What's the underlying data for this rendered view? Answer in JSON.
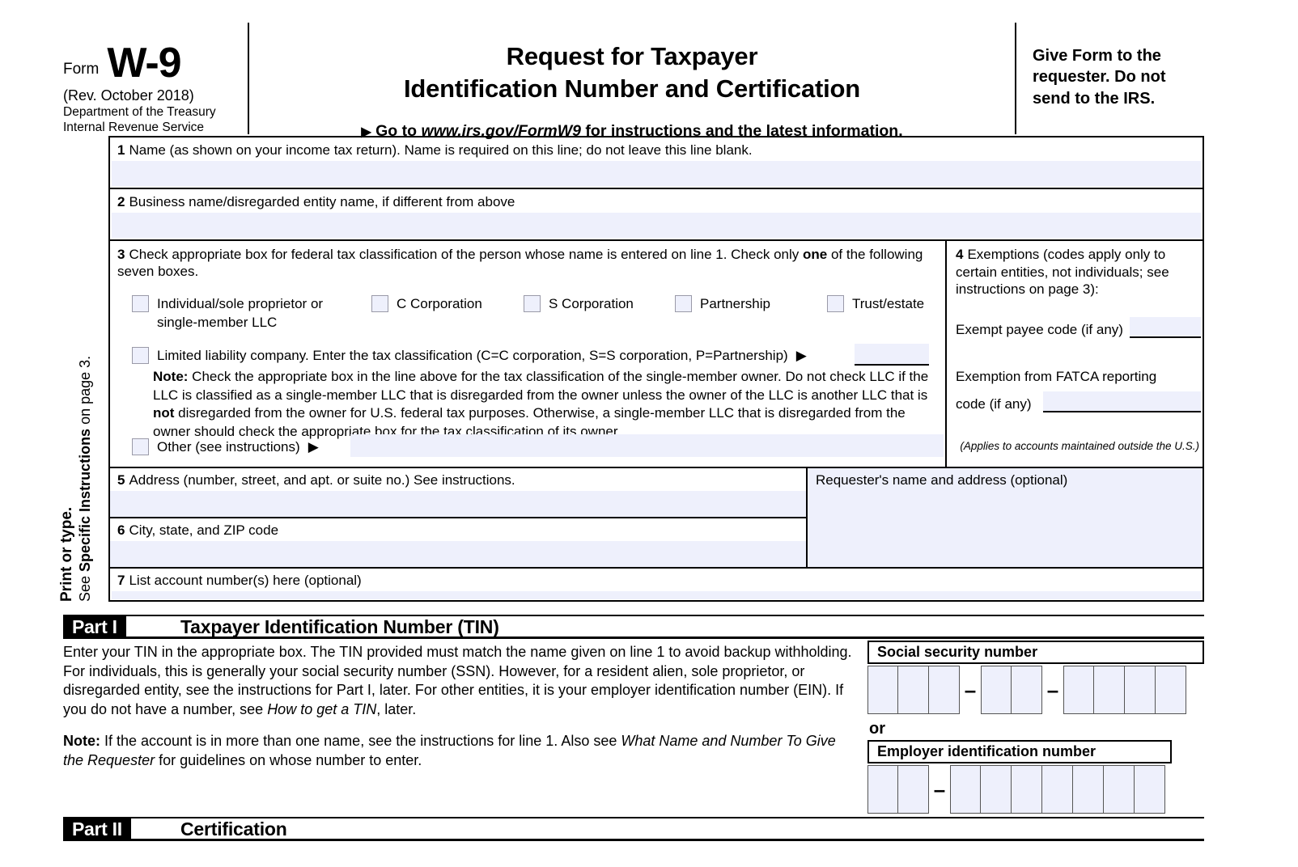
{
  "header": {
    "form_word": "Form",
    "form_number": "W-9",
    "revision": "(Rev. October 2018)",
    "dept_line1": "Department of the Treasury",
    "dept_line2": "Internal Revenue Service",
    "title_line1": "Request for Taxpayer",
    "title_line2": "Identification Number and Certification",
    "goto_arrow": "▶",
    "goto_prefix": "Go to",
    "goto_url": "www.irs.gov/FormW9",
    "goto_suffix": "for instructions and the latest information.",
    "give_form": "Give Form to the requester. Do not send to the IRS."
  },
  "sidebar": {
    "print_or_type": "Print or type.",
    "see_prefix": "See ",
    "see_bold": "Specific Instructions",
    "see_suffix": " on page 3."
  },
  "line1": {
    "number": "1",
    "label": "Name (as shown on your income tax return). Name is required on this line; do not leave this line blank.",
    "value": ""
  },
  "line2": {
    "number": "2",
    "label": "Business name/disregarded entity name, if different from above",
    "value": ""
  },
  "line3": {
    "number": "3",
    "intro_a": "Check appropriate box for federal tax classification of the person whose name is entered on line 1. Check only ",
    "intro_bold": "one",
    "intro_b": " of the following seven boxes.",
    "checkboxes": [
      {
        "id": "individual",
        "label": "Individual/sole proprietor or single-member LLC",
        "checked": false
      },
      {
        "id": "c-corporation",
        "label": "C Corporation",
        "checked": false
      },
      {
        "id": "s-corporation",
        "label": "S Corporation",
        "checked": false
      },
      {
        "id": "partnership",
        "label": "Partnership",
        "checked": false
      },
      {
        "id": "trust-estate",
        "label": "Trust/estate",
        "checked": false
      }
    ],
    "llc": {
      "label": "Limited liability company. Enter the tax classification (C=C corporation, S=S corporation, P=Partnership)",
      "arrow": "▶",
      "value": "",
      "checked": false
    },
    "note_bold": "Note:",
    "note_text_1": " Check the appropriate box in the line above for the tax classification of the single-member owner.  Do not check LLC if the LLC is classified as a single-member LLC that is disregarded from the owner unless the owner of the LLC is another LLC that is ",
    "note_bold_2": "not",
    "note_text_2": " disregarded from the owner for U.S. federal tax purposes. Otherwise, a single-member LLC that is disregarded from the owner should check the appropriate box for the tax classification of its owner.",
    "other": {
      "label": "Other (see instructions)",
      "arrow": "▶",
      "value": "",
      "checked": false
    }
  },
  "line4": {
    "number": "4",
    "heading": "Exemptions (codes apply only to certain entities, not individuals; see instructions on page 3):",
    "exempt_payee_label": "Exempt payee code (if any)",
    "exempt_payee_value": "",
    "fatca_label_line1": "Exemption from FATCA reporting",
    "fatca_label_line2": "code (if any)",
    "fatca_value": "",
    "applies_note": "(Applies to accounts maintained outside the U.S.)"
  },
  "line5": {
    "number": "5",
    "label": "Address (number, street, and apt. or suite no.) See instructions.",
    "value": ""
  },
  "line6": {
    "number": "6",
    "label": "City, state, and ZIP code",
    "value": ""
  },
  "requester": {
    "label": "Requester's name and address (optional)",
    "value": ""
  },
  "line7": {
    "number": "7",
    "label": "List account number(s) here (optional)",
    "value": ""
  },
  "part1": {
    "tag": "Part I",
    "title": "Taxpayer Identification Number (TIN)",
    "body_a": "Enter your TIN in the appropriate box. The TIN provided must match the name given on line 1 to avoid backup withholding. For individuals, this is generally your social security number (SSN). However, for a resident alien, sole proprietor, or disregarded entity, see the instructions for Part I, later. For other entities, it is your employer identification number (EIN). If you do not have a number, see ",
    "body_italic_1": "How to get a TIN",
    "body_b": ", later.",
    "note_bold": "Note:",
    "note_a": " If the account is in more than one name, see the instructions for line 1. Also see ",
    "note_italic": "What Name and Number To Give the Requester",
    "note_b": " for guidelines on whose number to enter.",
    "ssn_label": "Social security number",
    "ssn_groups": [
      3,
      2,
      4
    ],
    "ssn_values": [
      "",
      "",
      "",
      "",
      "",
      "",
      "",
      "",
      ""
    ],
    "or_label": "or",
    "ein_label": "Employer identification number",
    "ein_groups": [
      2,
      7
    ],
    "ein_values": [
      "",
      "",
      "",
      "",
      "",
      "",
      "",
      "",
      ""
    ],
    "dash": "–"
  },
  "part2": {
    "tag": "Part II",
    "title": "Certification"
  },
  "colors": {
    "field_fill": "#eef0fc",
    "rule": "#000000",
    "checkbox_border": "#9a9aa8"
  }
}
